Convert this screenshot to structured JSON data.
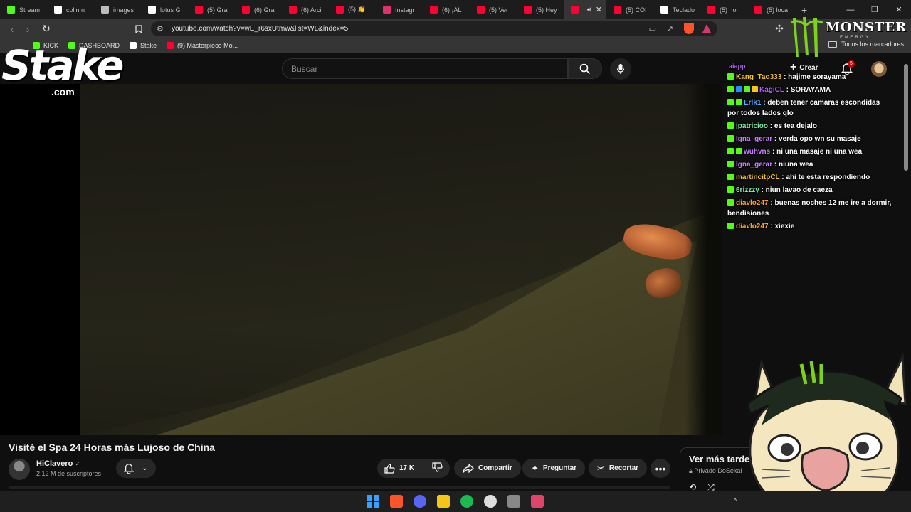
{
  "browser": {
    "tabs": [
      {
        "label": "Stream",
        "icon": "kick-icon",
        "color": "#53fc18",
        "active": false
      },
      {
        "label": "colin n",
        "icon": "google-icon",
        "color": "#ffffff",
        "active": false
      },
      {
        "label": "images",
        "icon": "web-icon",
        "color": "#bbbbbb",
        "active": false
      },
      {
        "label": "lotus G",
        "icon": "google-icon",
        "color": "#ffffff",
        "active": false
      },
      {
        "label": "(5) Gra",
        "icon": "youtube-icon",
        "color": "#ff0033",
        "active": false
      },
      {
        "label": "(6) Gra",
        "icon": "youtube-icon",
        "color": "#ff0033",
        "active": false
      },
      {
        "label": "(6) Arci",
        "icon": "youtube-icon",
        "color": "#ff0033",
        "active": false
      },
      {
        "label": "(5) 👏",
        "icon": "youtube-icon",
        "color": "#ff0033",
        "active": false
      },
      {
        "label": "Instagr",
        "icon": "instagram-icon",
        "color": "#e1306c",
        "active": false
      },
      {
        "label": "(6) ¡AL",
        "icon": "youtube-icon",
        "color": "#ff0033",
        "active": false
      },
      {
        "label": "(5) Ver",
        "icon": "youtube-icon",
        "color": "#ff0033",
        "active": false
      },
      {
        "label": "(5) Hey",
        "icon": "youtube-icon",
        "color": "#ff0033",
        "active": false
      },
      {
        "label": "",
        "icon": "youtube-icon",
        "color": "#ff0033",
        "active": true
      },
      {
        "label": "(5) COI",
        "icon": "youtube-icon",
        "color": "#ff0033",
        "active": false
      },
      {
        "label": "Teclado",
        "icon": "tiktok-icon",
        "color": "#ffffff",
        "active": false
      },
      {
        "label": "(5) hor",
        "icon": "youtube-icon",
        "color": "#ff0033",
        "active": false
      },
      {
        "label": "(5) loca",
        "icon": "youtube-icon",
        "color": "#ff0033",
        "active": false
      }
    ],
    "url": "youtube.com/watch?v=wE_r6sxUtmw&list=WL&index=5",
    "bookmarks": [
      {
        "label": "KICK",
        "color": "#53fc18"
      },
      {
        "label": "DASHBOARD",
        "color": "#53fc18"
      },
      {
        "label": "Stake",
        "color": "#ffffff"
      },
      {
        "label": "(9) Masterpiece Mo...",
        "color": "#ff0033"
      }
    ],
    "all_bookmarks": "Todos los marcadores"
  },
  "youtube": {
    "search_placeholder": "Buscar",
    "create_label": "Crear",
    "notifications_count": "5",
    "video_title": "Visité el Spa 24 Horas más Lujoso de China",
    "channel_name": "HiClavero",
    "subscribers": "2,12 M de suscriptores",
    "likes": "17 K",
    "share_label": "Compartir",
    "ask_label": "Preguntar",
    "clip_label": "Recortar",
    "watch_later_title": "Ver más tarde",
    "watch_later_sub": "Privado DoSekai"
  },
  "overlay": {
    "stake_logo": "Stake",
    "stake_com": ".com",
    "monster_brand": "MONSTER",
    "monster_sub": "ENERGY",
    "chat_top": "aiapp",
    "chat": [
      {
        "user": "Kang_Tao333",
        "text": ": hajime sorayama",
        "color": "#f5c518",
        "badges": []
      },
      {
        "user": "KagiCL",
        "text": ": SORAYAMA",
        "color": "#b45cff",
        "badges": [
          "#1e90ff",
          "#53fc18",
          "#f5c518"
        ]
      },
      {
        "user": "Erlk1",
        "text": ": deben tener camaras escondidas por todos lados qlo",
        "color": "#5aa9ff",
        "badges": [
          "#53fc18"
        ]
      },
      {
        "user": "jpatricioo",
        "text": ": es tea dejalo",
        "color": "#7ee7a6",
        "badges": []
      },
      {
        "user": "Igna_gerar",
        "text": ": verda opo wn su masaje",
        "color": "#c77dff",
        "badges": []
      },
      {
        "user": "wuhvns",
        "text": ": ni una masaje ni una wea",
        "color": "#c77dff",
        "badges": [
          "#53fc18"
        ]
      },
      {
        "user": "Igna_gerar",
        "text": ": niuna wea",
        "color": "#c77dff",
        "badges": []
      },
      {
        "user": "martincitpCL",
        "text": ": ahi te esta respondiendo",
        "color": "#f5c518",
        "badges": []
      },
      {
        "user": "6rizzzy",
        "text": ": niun lavao de caeza",
        "color": "#7ee7a6",
        "badges": []
      },
      {
        "user": "diavlo247",
        "text": ": buenas noches 12 me ire a dormir, bendisiones",
        "color": "#ff9f2e",
        "badges": []
      },
      {
        "user": "diavlo247",
        "text": ": xiexie",
        "color": "#ff9f2e",
        "badges": []
      }
    ]
  },
  "taskbar": {
    "apps": [
      {
        "name": "windows-start-icon",
        "color": "#3aa0ff"
      },
      {
        "name": "brave-icon",
        "color": "#fb542b"
      },
      {
        "name": "discord-icon",
        "color": "#5865f2"
      },
      {
        "name": "file-explorer-icon",
        "color": "#f5c518"
      },
      {
        "name": "spotify-icon",
        "color": "#1db954"
      },
      {
        "name": "obs-icon",
        "color": "#dddddd"
      },
      {
        "name": "app-icon",
        "color": "#888888"
      },
      {
        "name": "vpn-icon",
        "color": "#e0446a"
      }
    ]
  }
}
